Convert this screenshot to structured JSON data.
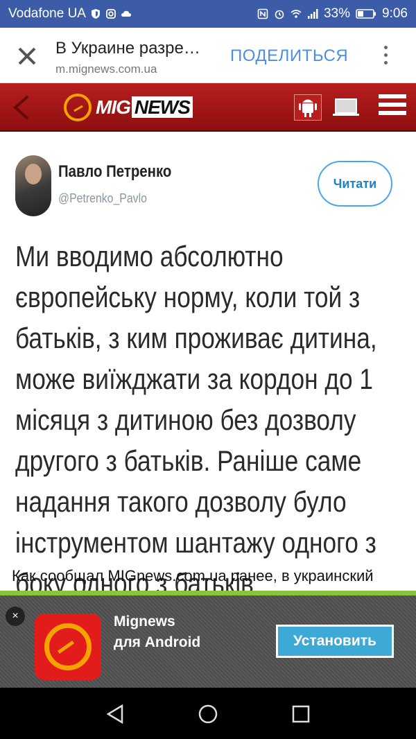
{
  "status_bar": {
    "carrier": "Vodafone UA",
    "battery": "33%",
    "time": "9:06"
  },
  "browser": {
    "page_title": "В Украине разре…",
    "url": "m.mignews.com.ua",
    "share_label": "ПОДЕЛИТЬСЯ"
  },
  "site": {
    "logo_mig": "MIG",
    "logo_news": "NEWS"
  },
  "tweet": {
    "author_name": "Павло Петренко",
    "author_handle": "@Petrenko_Pavlo",
    "read_button": "Читати",
    "text": "Ми вводимо абсолютно європейську нормy, коли той з батьків, з ким проживає дитина, може виїжджати за кордон до 1 місяця з дитиною без дозволу другого з батьків. Раніше саме надання такого дозволу було інструментом шантажу одного з боку одного з батьків"
  },
  "article": {
    "paragraph_start": "Как сообщал MIGnews.com.ua ранее, в украинский"
  },
  "ad": {
    "close": "×",
    "title": "Mignews",
    "subtitle": "для Android",
    "install_label": "Установить"
  },
  "colors": {
    "status_bar": "#3d5ca8",
    "site_header": "#b81e1e",
    "accent_orange": "#f5a300",
    "share_blue": "#4a8ee6",
    "install_blue": "#3ca9d6",
    "ad_top_border": "#8ac43f"
  }
}
